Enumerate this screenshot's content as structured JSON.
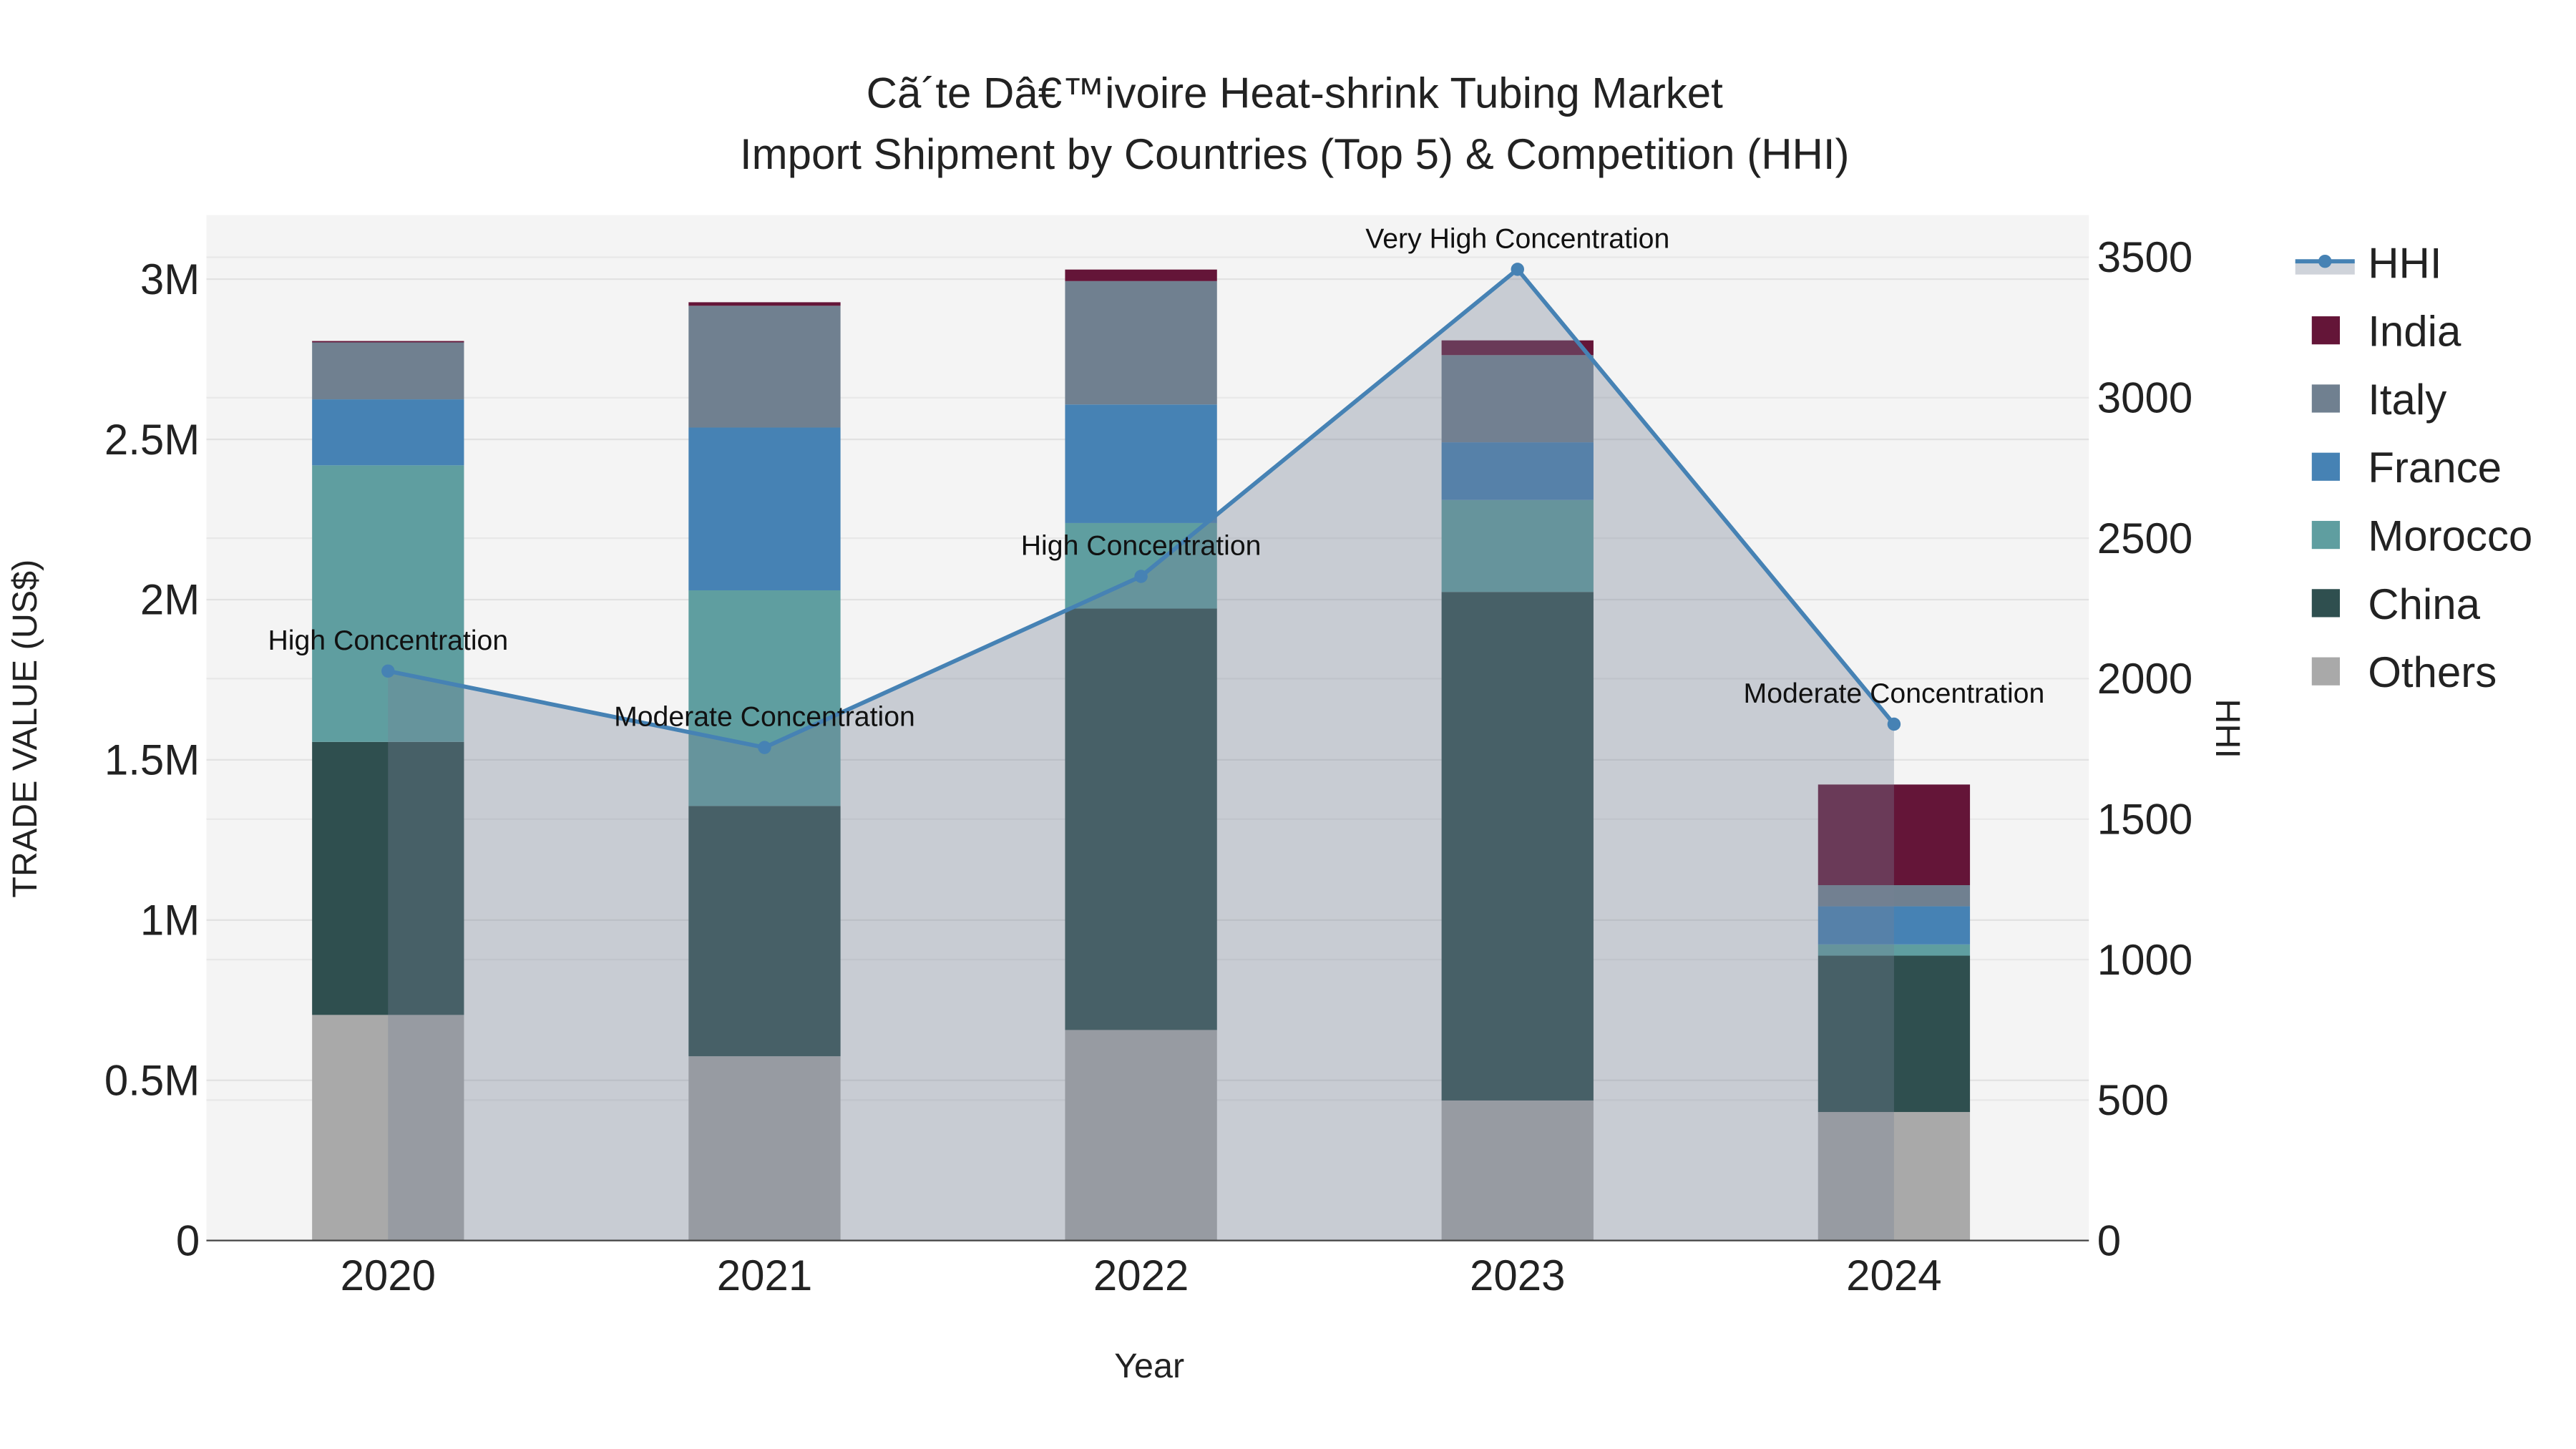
{
  "chart_data": {
    "type": "bar",
    "title": "Cã´te Dâ€™ivoire Heat-shrink Tubing Market",
    "subtitle": "Import Shipment by Countries (Top 5) & Competition (HHI)",
    "xlabel": "Year",
    "ylabel": "TRADE VALUE (US$)",
    "y2label": "HHI",
    "categories": [
      "2020",
      "2021",
      "2022",
      "2023",
      "2024"
    ],
    "ylim": [
      0,
      3200000
    ],
    "y2lim": [
      0,
      3650
    ],
    "yticks": [
      0,
      500000,
      1000000,
      1500000,
      2000000,
      2500000,
      3000000
    ],
    "ytick_labels": [
      "0",
      "0.5M",
      "1M",
      "1.5M",
      "2M",
      "2.5M",
      "3M"
    ],
    "y2ticks": [
      0,
      500,
      1000,
      1500,
      2000,
      2500,
      3000,
      3500
    ],
    "y2tick_labels": [
      "0",
      "500",
      "1000",
      "1500",
      "2000",
      "2500",
      "3000",
      "3500"
    ],
    "series": [
      {
        "name": "Others",
        "color": "#a9a9a9",
        "values": [
          704000,
          575000,
          657000,
          437000,
          401000
        ]
      },
      {
        "name": "China",
        "color": "#2f4f4f",
        "values": [
          852000,
          781000,
          1315000,
          1587000,
          488000
        ]
      },
      {
        "name": "Morocco",
        "color": "#5f9ea0",
        "values": [
          863000,
          673000,
          267000,
          287000,
          35000
        ]
      },
      {
        "name": "France",
        "color": "#4682b4",
        "values": [
          206000,
          508000,
          370000,
          180000,
          119000
        ]
      },
      {
        "name": "Italy",
        "color": "#708090",
        "values": [
          179000,
          380000,
          385000,
          272000,
          66000
        ]
      },
      {
        "name": "India",
        "color": "#641538",
        "values": [
          3000,
          11000,
          36000,
          46000,
          314000
        ]
      }
    ],
    "hhi": {
      "name": "HHI",
      "color": "#4682b4",
      "values": [
        2027,
        1755,
        2364,
        3457,
        1838
      ],
      "annotations": [
        "High Concentration",
        "Moderate Concentration",
        "High Concentration",
        "Very High Concentration",
        "Moderate Concentration"
      ]
    },
    "legend_order": [
      "HHI",
      "India",
      "Italy",
      "France",
      "Morocco",
      "China",
      "Others"
    ],
    "legend_placement": "top-right",
    "grid": true
  }
}
